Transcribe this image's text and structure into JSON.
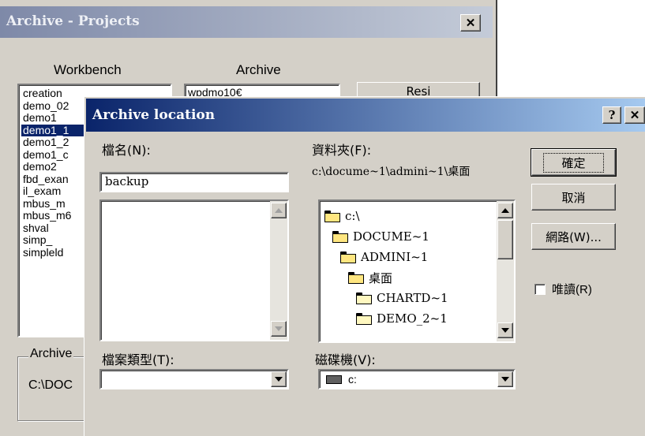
{
  "archive_window": {
    "title": "Archive - Projects",
    "close_glyph": "✕",
    "workbench_label": "Workbench",
    "archive_label": "Archive",
    "workbench_items": [
      "creation",
      "demo_02",
      "demo1",
      "demo1_1",
      "demo1_2",
      "demo1_c",
      "demo2",
      "fbd_exan",
      "il_exam",
      "mbus_m",
      "mbus_m6",
      "shval",
      "simp_",
      "simpleld"
    ],
    "selected_item": "demo1_1",
    "archive_items": [
      "wpdmo10€"
    ],
    "partial_button_label": "Resi",
    "archive_group_label": "Archive",
    "archive_path": "C:\\DOC"
  },
  "dialog": {
    "title": "Archive location",
    "help_glyph": "?",
    "close_glyph": "✕",
    "filename_label": "檔名(N):",
    "filename_value": "backup",
    "filetype_label": "檔案類型(T):",
    "folder_label": "資料夾(F):",
    "folder_path": "c:\\docume~1\\admini~1\\桌面",
    "folders": [
      {
        "name": "c:\\",
        "state": "open"
      },
      {
        "name": "DOCUME~1",
        "state": "open"
      },
      {
        "name": "ADMINI~1",
        "state": "open"
      },
      {
        "name": "桌面",
        "state": "open-selected"
      },
      {
        "name": "CHARTD~1",
        "state": "closed"
      },
      {
        "name": "DEMO_2~1",
        "state": "closed"
      }
    ],
    "drives_label": "磁碟機(V):",
    "drive_value": "c:",
    "ok_label": "確定",
    "cancel_label": "取消",
    "network_label": "網路(W)...",
    "readonly_label": "唯讀(R)",
    "readonly_checked": false
  }
}
